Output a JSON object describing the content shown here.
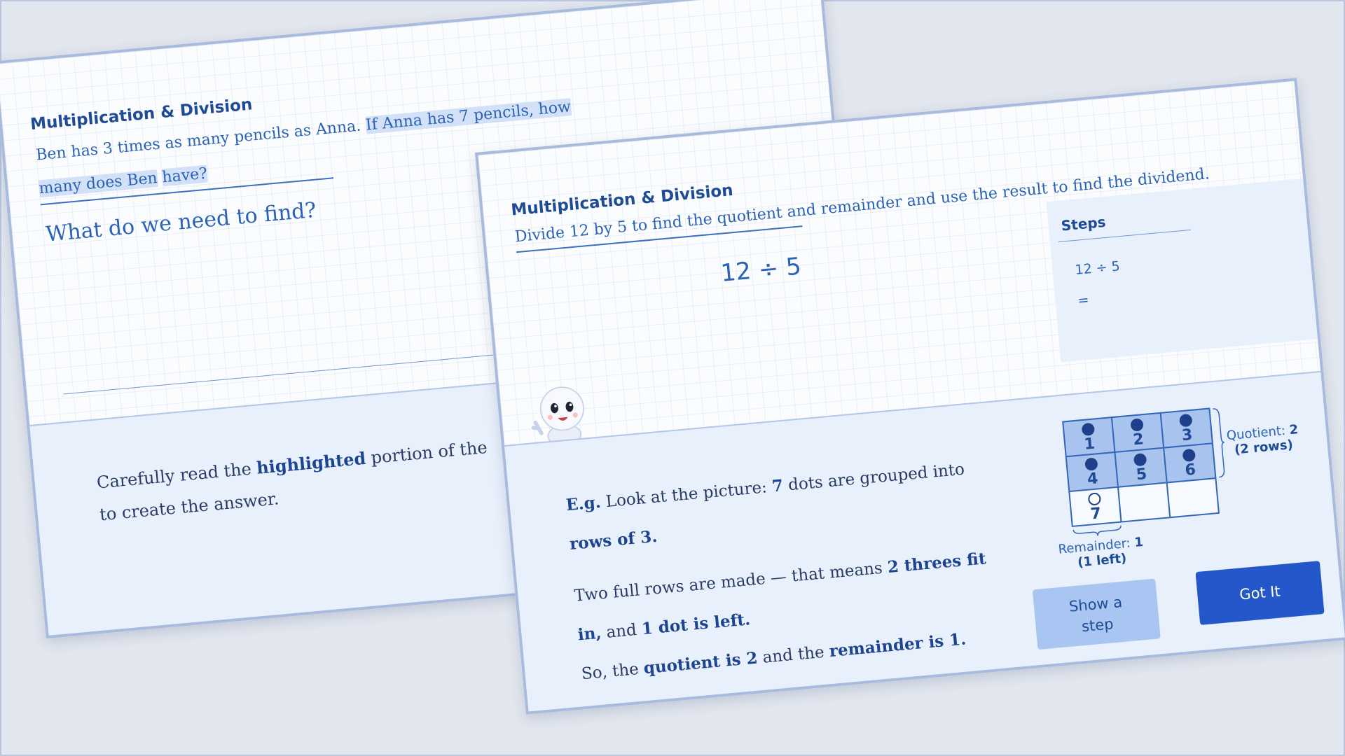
{
  "back_card": {
    "subject": "Multiplication & Division",
    "prompt_plain": "Ben has 3 times as many pencils as Anna.",
    "prompt_highlight_1": "If Anna has 7 pencils, how many does Ben",
    "prompt_highlight_2": "have?",
    "question": "What do we need to find?",
    "tip": {
      "part1": "Carefully read the",
      "bold": "highlighted",
      "part2": "portion of the",
      "part3": "to create the answer."
    }
  },
  "front_card": {
    "subject": "Multiplication & Division",
    "prompt": "Divide 12 by 5 to find the quotient and remainder and use the result to find the dividend.",
    "expression": "12 ÷ 5",
    "steps": {
      "title": "Steps",
      "line1": "12 ÷ 5",
      "line2": "="
    },
    "explanation": {
      "eg": "E.g.",
      "t1": "Look at the picture:",
      "b1": "7",
      "t2": "dots are grouped into",
      "b2": "rows of 3.",
      "t3": "Two full rows are made — that means",
      "b3a": "2 threes fit",
      "b3b": "in,",
      "t4": "and",
      "b4": "1 dot is left.",
      "t5": "So, the",
      "b5": "quotient is 2",
      "t6": "and the",
      "b6": "remainder is 1."
    },
    "figure": {
      "cells": [
        "1",
        "2",
        "3",
        "4",
        "5",
        "6",
        "7"
      ],
      "quotient_label": "Quotient:",
      "quotient_value": "2",
      "quotient_sub": "(2 rows)",
      "remainder_label": "Remainder:",
      "remainder_value": "1",
      "remainder_sub": "(1 left)"
    },
    "buttons": {
      "show_step_line1": "Show a",
      "show_step_line2": "step",
      "got_it": "Got It"
    }
  },
  "colors": {
    "background": "#e2e6ee",
    "accent": "#2457c9",
    "text_blue": "#2a62b4",
    "highlight": "#d2e0f8",
    "panel": "#e8f0fb"
  },
  "icons": [
    "mascot-icon",
    "dot-icon"
  ]
}
